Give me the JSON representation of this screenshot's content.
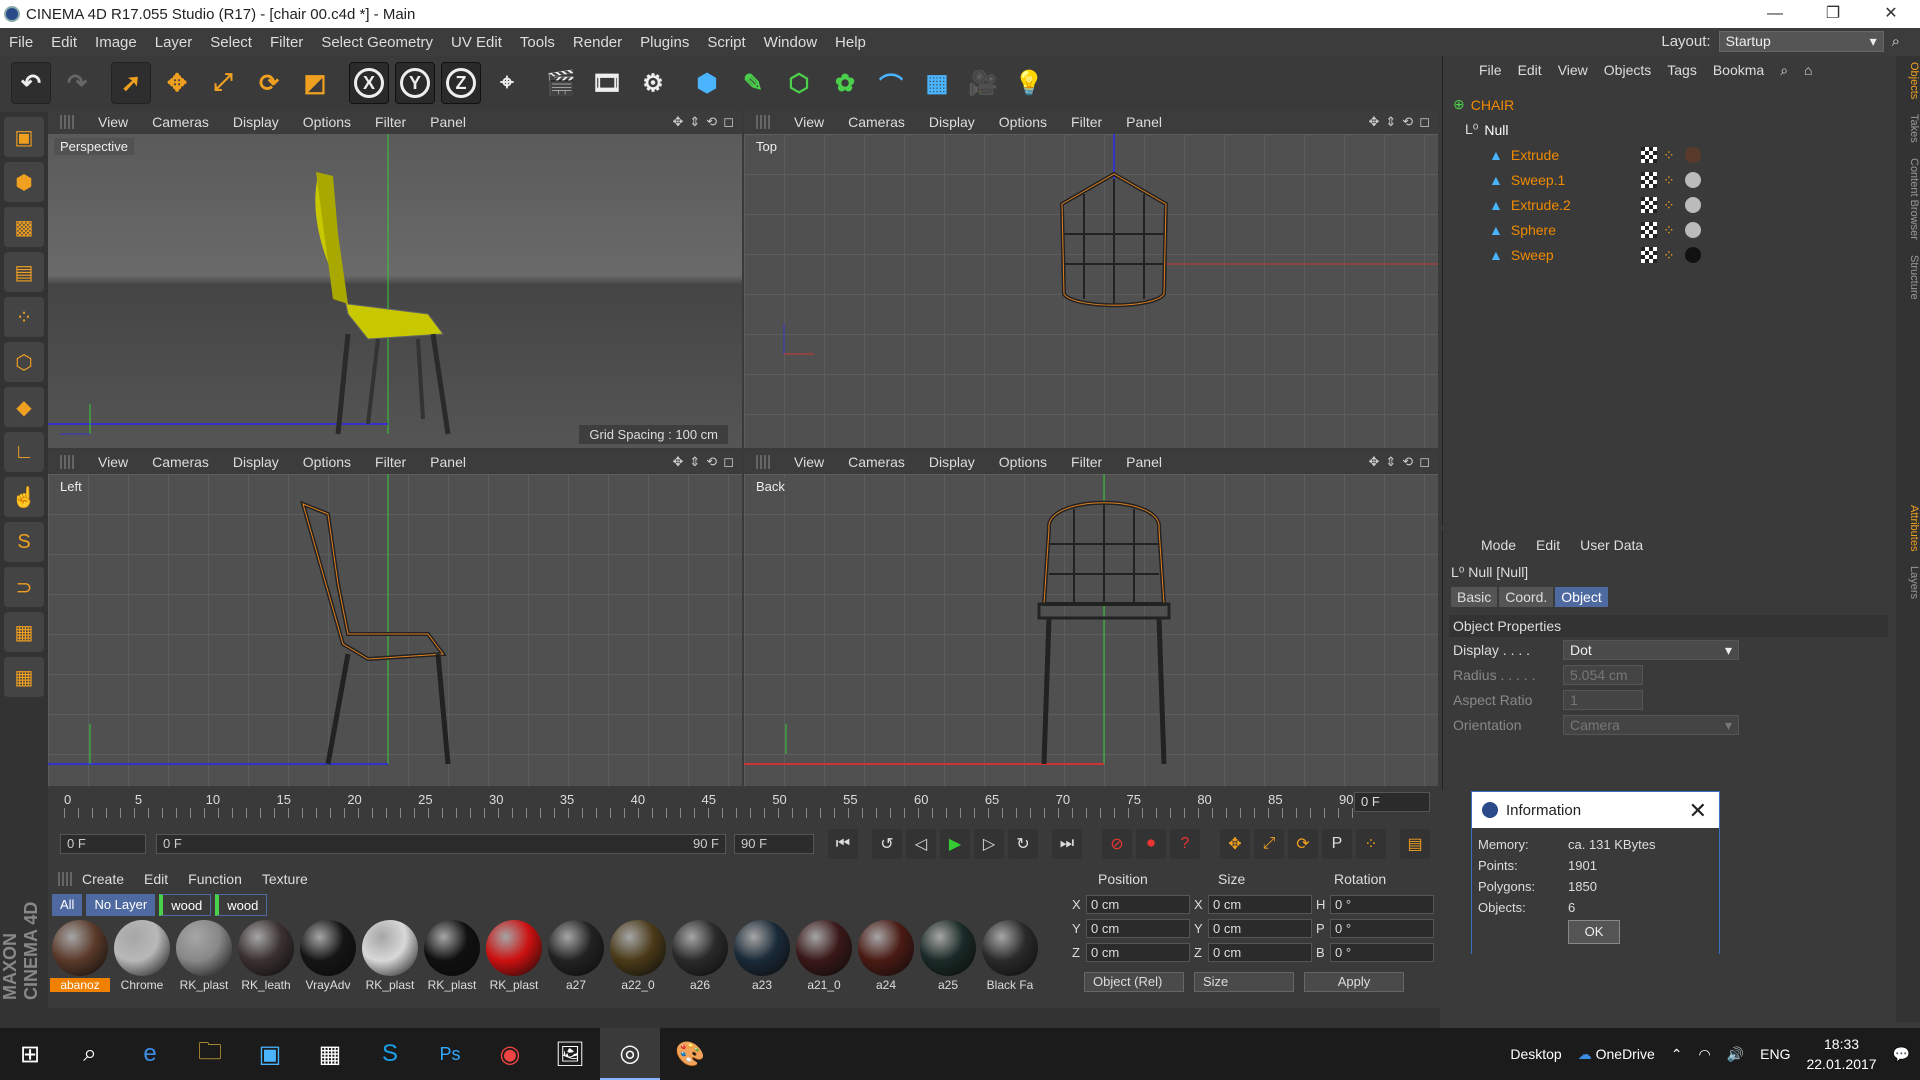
{
  "window": {
    "title": "CINEMA 4D R17.055 Studio (R17) - [chair 00.c4d *] - Main"
  },
  "menu": [
    "File",
    "Edit",
    "Image",
    "Layer",
    "Select",
    "Filter",
    "Select Geometry",
    "UV Edit",
    "Tools",
    "Render",
    "Plugins",
    "Script",
    "Window",
    "Help"
  ],
  "layout": {
    "label": "Layout:",
    "value": "Startup"
  },
  "viewport_menu": [
    "View",
    "Cameras",
    "Display",
    "Options",
    "Filter",
    "Panel"
  ],
  "viewports": {
    "perspective": {
      "name": "Perspective",
      "grid_spacing": "Grid Spacing : 100 cm"
    },
    "top": {
      "name": "Top"
    },
    "left": {
      "name": "Left"
    },
    "back": {
      "name": "Back"
    }
  },
  "timeline": {
    "ticks": [
      "0",
      "5",
      "10",
      "15",
      "20",
      "25",
      "30",
      "35",
      "40",
      "45",
      "50",
      "55",
      "60",
      "65",
      "70",
      "75",
      "80",
      "85",
      "90"
    ],
    "current_frame": "0 F",
    "start": "0 F",
    "range_start": "0 F",
    "range_end": "90 F",
    "end": "90 F"
  },
  "materials": {
    "menu": [
      "Create",
      "Edit",
      "Function",
      "Texture"
    ],
    "tabs": [
      "All",
      "No Layer",
      "wood",
      "wood"
    ],
    "items": [
      {
        "name": "abanoz",
        "color": "#5a3a2a"
      },
      {
        "name": "Chrome",
        "color": "#b8b8b8"
      },
      {
        "name": "RK_plast",
        "color": "#888888"
      },
      {
        "name": "RK_leath",
        "color": "#3a3030"
      },
      {
        "name": "VrayAdv",
        "color": "#151515"
      },
      {
        "name": "RK_plast",
        "color": "#d8d8d8"
      },
      {
        "name": "RK_plast",
        "color": "#101010"
      },
      {
        "name": "RK_plast",
        "color": "#cc1010"
      },
      {
        "name": "a27",
        "color": "#222222"
      },
      {
        "name": "a22_0",
        "color": "#4a3a18"
      },
      {
        "name": "a26",
        "color": "#2a2a2a"
      },
      {
        "name": "a23",
        "color": "#1a2a38"
      },
      {
        "name": "a21_0",
        "color": "#3a1818"
      },
      {
        "name": "a24",
        "color": "#4a1a14"
      },
      {
        "name": "a25",
        "color": "#1a2a26"
      },
      {
        "name": "Black Fa",
        "color": "#2a2a2a"
      }
    ]
  },
  "coords": {
    "headers": [
      "Position",
      "Size",
      "Rotation"
    ],
    "rows": [
      {
        "a": "X",
        "pos": "0 cm",
        "b": "X",
        "size": "0 cm",
        "c": "H",
        "rot": "0 °"
      },
      {
        "a": "Y",
        "pos": "0 cm",
        "b": "Y",
        "size": "0 cm",
        "c": "P",
        "rot": "0 °"
      },
      {
        "a": "Z",
        "pos": "0 cm",
        "b": "Z",
        "size": "0 cm",
        "c": "B",
        "rot": "0 °"
      }
    ],
    "mode": "Object (Rel)",
    "size_mode": "Size",
    "apply": "Apply"
  },
  "objects": {
    "menu": [
      "File",
      "Edit",
      "View",
      "Objects",
      "Tags",
      "Bookma"
    ],
    "tree": [
      {
        "name": "CHAIR",
        "kind": "root"
      },
      {
        "name": "Null",
        "kind": "null"
      },
      {
        "name": "Extrude",
        "kind": "child"
      },
      {
        "name": "Sweep.1",
        "kind": "child"
      },
      {
        "name": "Extrude.2",
        "kind": "child"
      },
      {
        "name": "Sphere",
        "kind": "child"
      },
      {
        "name": "Sweep",
        "kind": "child"
      }
    ]
  },
  "attributes": {
    "menu": [
      "Mode",
      "Edit",
      "User Data"
    ],
    "title": "Null [Null]",
    "tabs": [
      "Basic",
      "Coord.",
      "Object"
    ],
    "section": "Object Properties",
    "props": [
      {
        "label": "Display . . . .",
        "value": "Dot"
      },
      {
        "label": "Radius . . . . .",
        "value": "5.054 cm"
      },
      {
        "label": "Aspect Ratio",
        "value": "1"
      },
      {
        "label": "Orientation",
        "value": "Camera"
      }
    ]
  },
  "info_dialog": {
    "title": "Information",
    "rows": [
      {
        "k": "Memory:",
        "v": "ca. 131 KBytes"
      },
      {
        "k": "Points:",
        "v": "1901"
      },
      {
        "k": "Polygons:",
        "v": "1850"
      },
      {
        "k": "Objects:",
        "v": "6"
      }
    ],
    "ok": "OK"
  },
  "right_tabs": [
    "Objects",
    "Takes",
    "Content Browser",
    "Structure",
    "Attributes",
    "Layers"
  ],
  "brand": "MAXON CINEMA 4D",
  "taskbar": {
    "desktop": "Desktop",
    "onedrive": "OneDrive",
    "lang": "ENG",
    "time": "18:33",
    "date": "22.01.2017"
  }
}
